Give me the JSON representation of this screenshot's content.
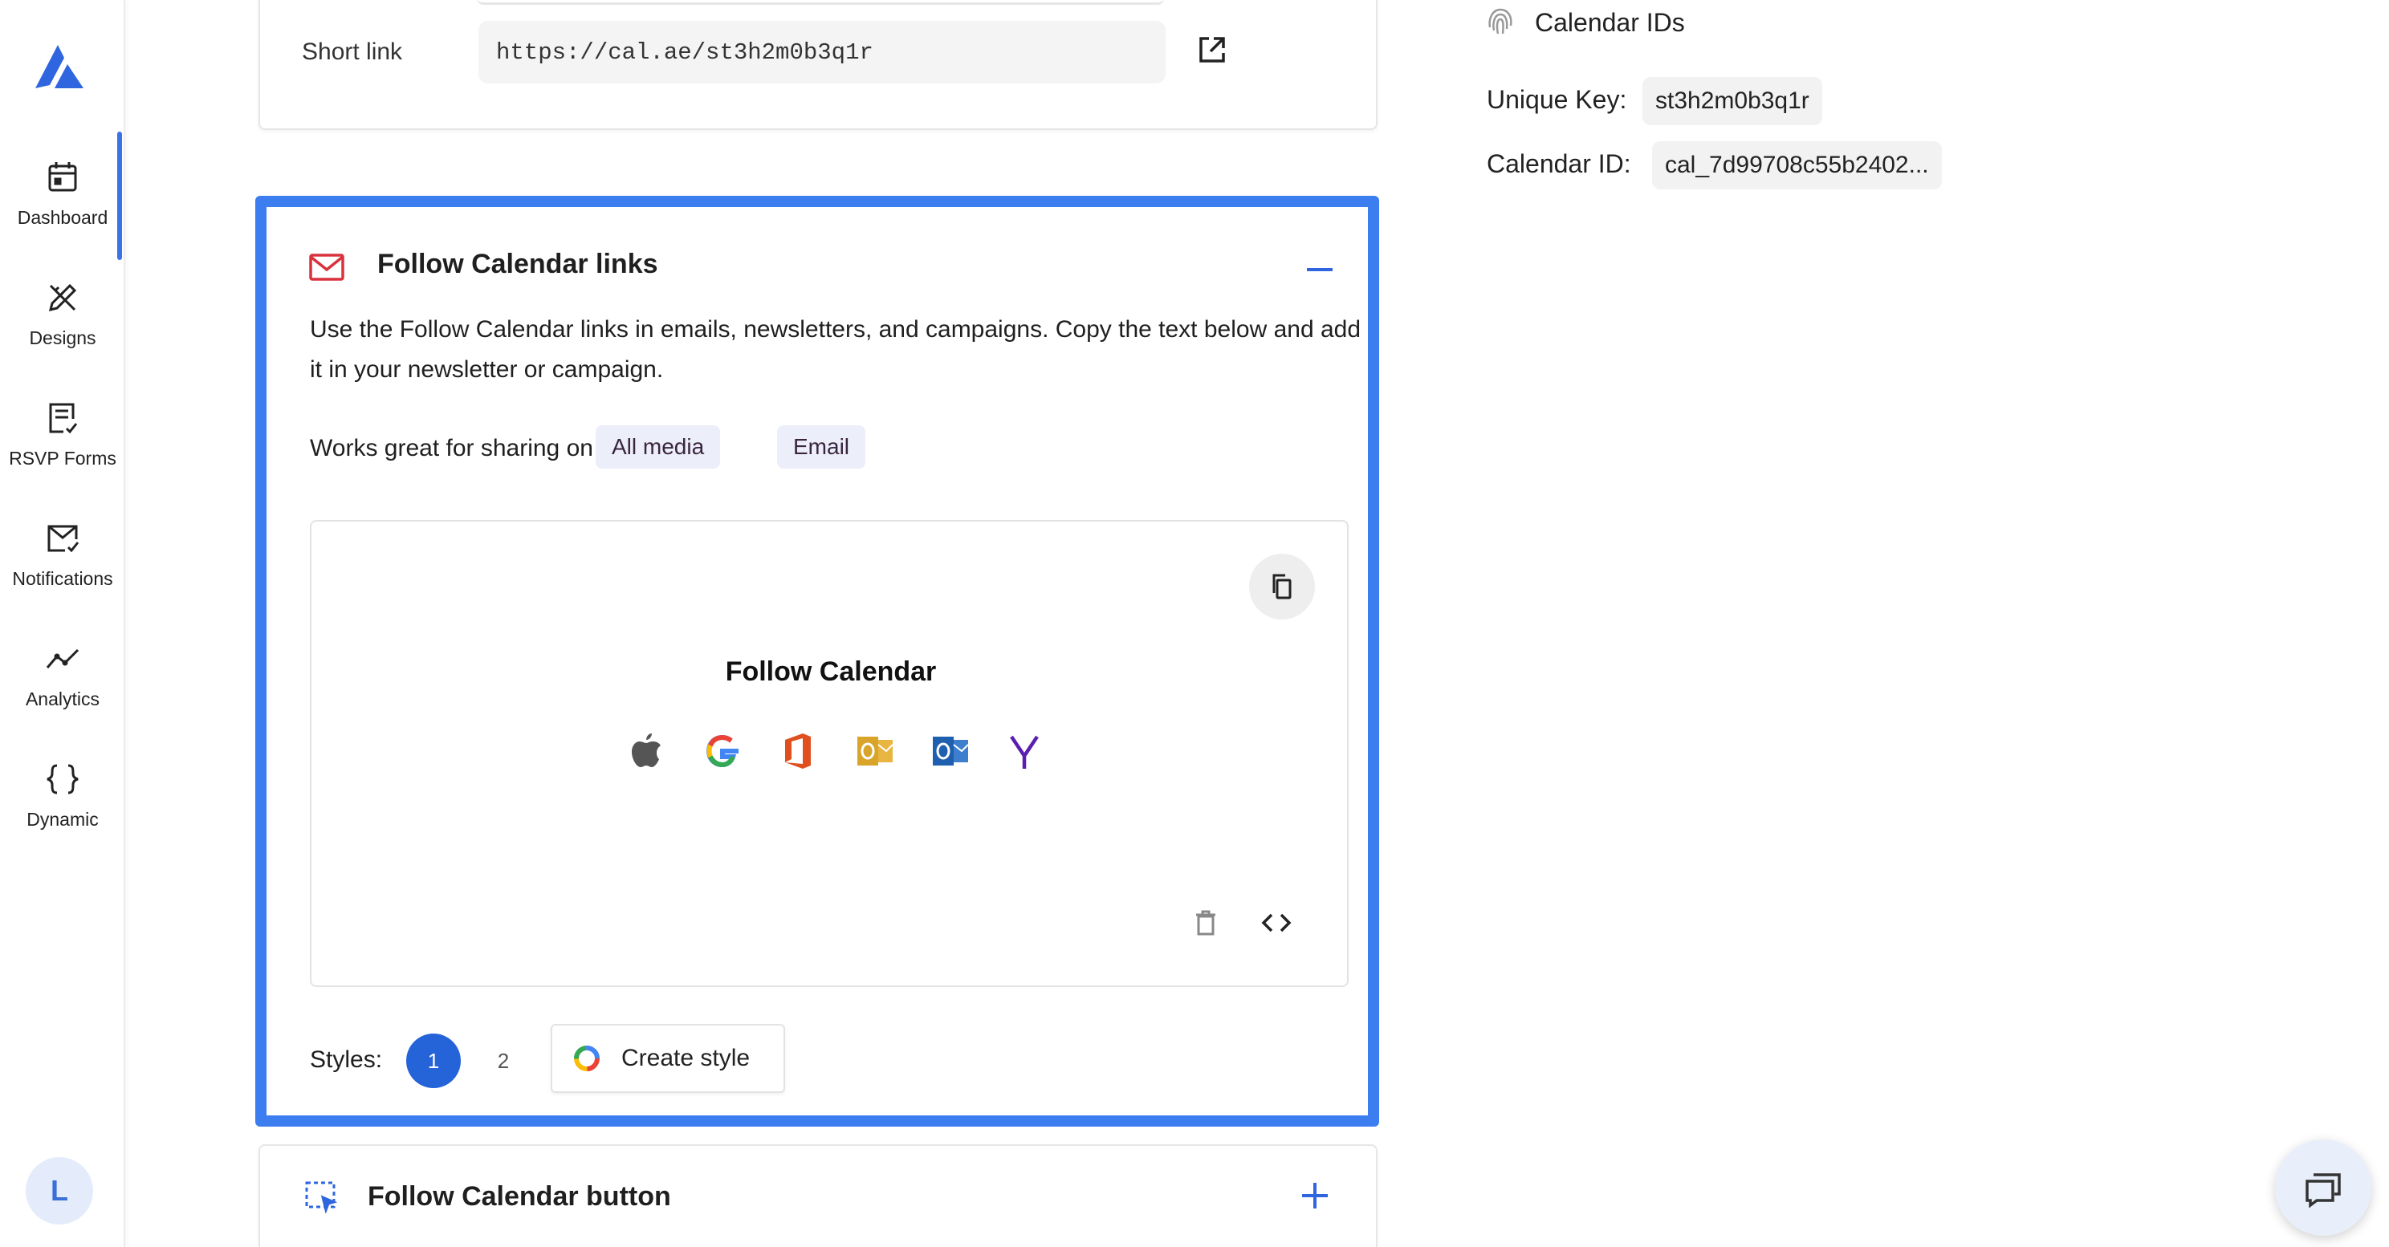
{
  "sidebar": {
    "items": [
      {
        "label": "Dashboard",
        "icon": "calendar-icon"
      },
      {
        "label": "Designs",
        "icon": "pencil-ruler-icon"
      },
      {
        "label": "RSVP Forms",
        "icon": "checklist-form-icon"
      },
      {
        "label": "Notifications",
        "icon": "envelope-check-icon"
      },
      {
        "label": "Analytics",
        "icon": "line-chart-icon"
      },
      {
        "label": "Dynamic",
        "icon": "curly-braces-icon"
      }
    ],
    "active": "Dashboard",
    "avatar_initial": "L",
    "accent": "#3b73e6"
  },
  "short_link": {
    "label": "Short link",
    "value": "https://cal.ae/st3h2m0b3q1r"
  },
  "follow_links": {
    "title": "Follow Calendar links",
    "description": "Use the Follow Calendar links in emails, newsletters, and campaigns. Copy the text below and add it in your newsletter or campaign.",
    "works_label": "Works great for sharing on",
    "tags": [
      "All media",
      "Email"
    ],
    "preview_title": "Follow Calendar",
    "calendar_icons": [
      "apple-icon",
      "google-icon",
      "office-icon",
      "outlook-icon",
      "outlook-com-icon",
      "yahoo-icon"
    ],
    "styles_label": "Styles:",
    "styles": [
      "1",
      "2"
    ],
    "active_style": "1",
    "create_style_label": "Create style",
    "highlight_color": "#3c7ef0"
  },
  "follow_button": {
    "title": "Follow Calendar button"
  },
  "calendar_ids": {
    "title": "Calendar IDs",
    "unique_key_label": "Unique Key:",
    "unique_key": "st3h2m0b3q1r",
    "calendar_id_label": "Calendar ID:",
    "calendar_id": "cal_7d99708c55b2402..."
  }
}
